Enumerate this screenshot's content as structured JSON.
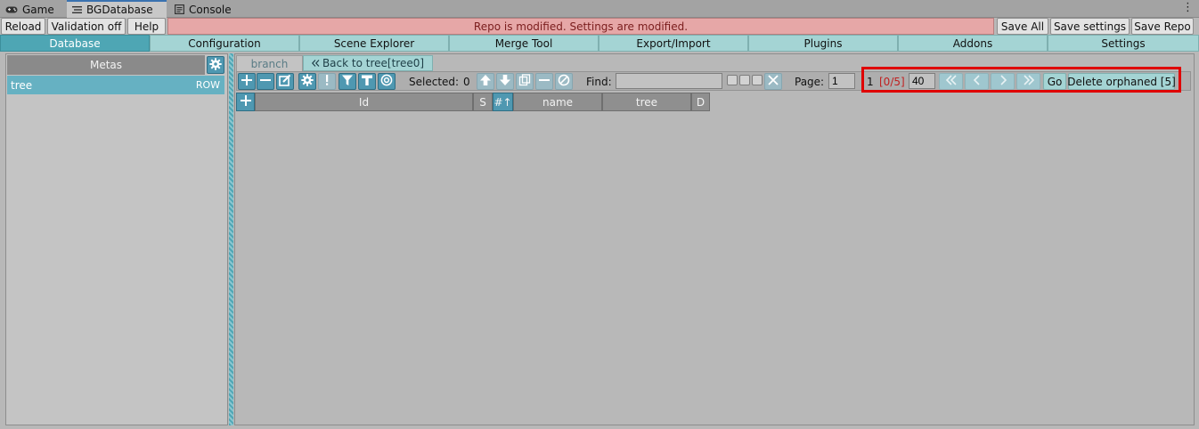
{
  "window_tabs": [
    {
      "label": "Game",
      "icon": "gamepad-icon"
    },
    {
      "label": "BGDatabase",
      "icon": "list-icon"
    },
    {
      "label": "Console",
      "icon": "console-icon"
    }
  ],
  "toolbar": {
    "reload": "Reload",
    "validation": "Validation off",
    "help": "Help",
    "banner": "Repo is modified. Settings are modified.",
    "save_all": "Save All",
    "save_settings": "Save settings",
    "save_repo": "Save Repo"
  },
  "main_tabs": [
    "Database",
    "Configuration",
    "Scene Explorer",
    "Merge Tool",
    "Export/Import",
    "Plugins",
    "Addons",
    "Settings"
  ],
  "active_main_tab": "Database",
  "left_panel": {
    "header": "Metas",
    "metas": [
      {
        "name": "tree",
        "type": "ROW"
      }
    ]
  },
  "sub_tabs": {
    "branch": "branch",
    "back": "Back to tree[tree0]"
  },
  "grid_toolbar": {
    "selected_label": "Selected:",
    "selected_count": "0",
    "find_label": "Find:",
    "find_value": "",
    "page_label": "Page:",
    "page_value": "1",
    "page_count": "1",
    "counter": "[0/5]",
    "page_size": "40",
    "go": "Go",
    "delete_orphaned": "Delete orphaned [5]"
  },
  "table": {
    "columns": [
      "Id",
      "S",
      "#↑",
      "name",
      "tree",
      "D"
    ]
  },
  "colors": {
    "accent": "#4f98b1",
    "tab_bg": "#a4d4d4",
    "active_tab": "#4ea6b4",
    "banner_bg": "#e6a7a7",
    "banner_text": "#7a1d1d",
    "counter_text": "#c02020",
    "highlight_box": "#e00000"
  }
}
